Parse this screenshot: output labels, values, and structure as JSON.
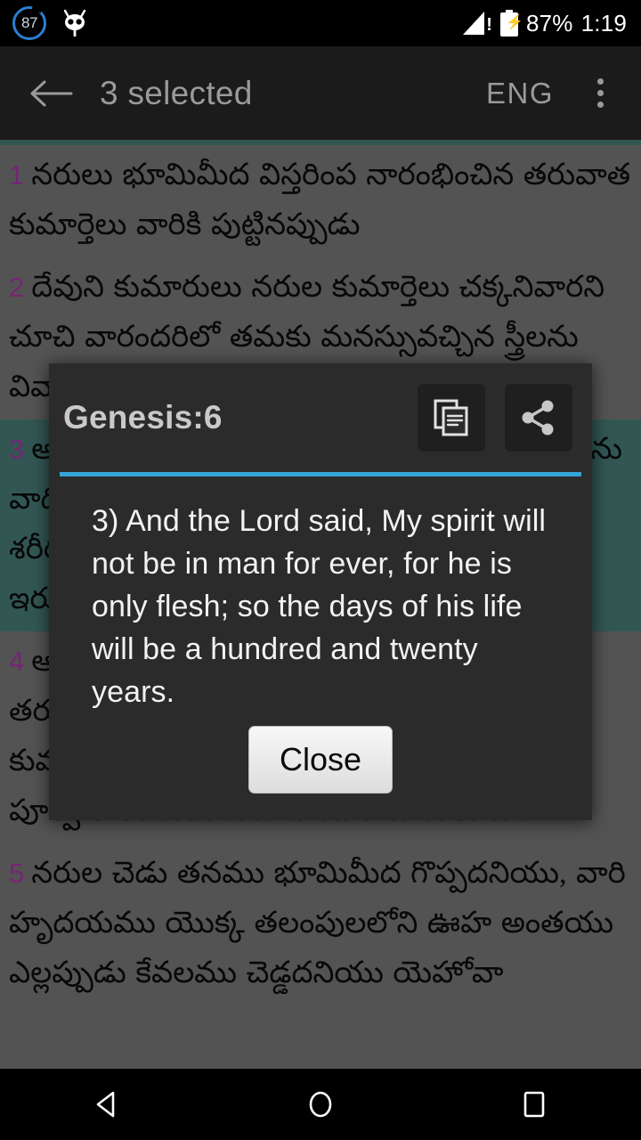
{
  "status_bar": {
    "battery_ring_value": "87",
    "cid_icon": "cyanogenmod-mascot-icon",
    "signal_icon": "signal-warning-icon",
    "battery_icon": "battery-charging-icon",
    "battery_percent": "87%",
    "clock": "1:19"
  },
  "app_bar": {
    "back_icon": "back-arrow-icon",
    "title": "3 selected",
    "language": "ENG",
    "overflow_icon": "overflow-menu-icon"
  },
  "content": {
    "verses": [
      {
        "number": "1",
        "text": "నరులు భూమిమీద విస్తరింప నారంభించిన తరువాత కుమార్తెలు వారికి పుట్టినప్పుడు",
        "selected": false
      },
      {
        "number": "2",
        "text": "దేవుని కుమారులు నరుల కుమార్తెలు చక్కనివారని చూచి వారందరిలో తమకు మనస్సువచ్చిన స్త్రీలను వివాహము చేసికొనిరి.",
        "selected": false
      },
      {
        "number": "3",
        "text": "అప్పుడు యెహోవా నా ఆత్మ నరులతో ఎల్లప్పుడును వాదించదు; వారు తమ అක్రమవిషయములో శరీరులై యున్నారు గనుక వారి దినములు నూట ఇరువది యేండ్లగుననెను.",
        "selected": true
      },
      {
        "number": "4",
        "text": "ఆ దినములలో నెఫీలులు భూమి మీద నుండిరి; తరువాతను నుండిరి. దేవుని కుమారులు నరుల కుమార్తెలతో పోయినప్పుడు వారికి పిల్లలను కనిరి. పూర్వ కాలమందు పేరు పొందిన శూరులు వీరే.",
        "selected": false
      },
      {
        "number": "5",
        "text": "నరుల చెడు తనము భూమిమీద గొప్పదనియు, వారి హృదయము యొక్క తలంపులలోని ఊహ అంతయు ఎల్లప్పుడు కేవలము చెడ్డదనియు యెహోవా",
        "selected": false
      }
    ]
  },
  "dialog": {
    "title": "Genesis:6",
    "copy_icon": "copy-icon",
    "share_icon": "share-icon",
    "body_text": "3) And the Lord said, My spirit will not be in man for ever, for he is only flesh; so the days of his life will be a hundred and twenty years.",
    "close_label": "Close"
  },
  "nav_bar": {
    "back_icon": "nav-back-triangle-icon",
    "home_icon": "nav-home-circle-icon",
    "recents_icon": "nav-recents-square-icon"
  },
  "colors": {
    "page_background": "#666666",
    "app_bar": "#1b1b1b",
    "dialog_background": "#2b2b2b",
    "dialog_accent": "#33a5d8",
    "selection_highlight": "#3d6b66",
    "verse_number": "#8e2f8e",
    "status_bar": "#000000"
  }
}
